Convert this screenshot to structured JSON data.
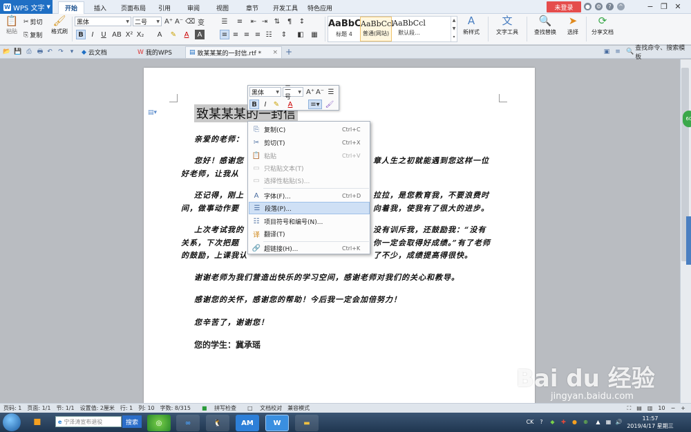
{
  "app": {
    "name": "WPS 文字"
  },
  "menu": [
    "开始",
    "插入",
    "页面布局",
    "引用",
    "审阅",
    "视图",
    "章节",
    "开发工具",
    "特色应用"
  ],
  "login_label": "未登录",
  "ribbon": {
    "paste": "粘贴",
    "cut": "剪切",
    "copy": "复制",
    "format_painter": "格式刷",
    "font_name": "黑体",
    "font_size": "二号",
    "styles": [
      {
        "preview": "AaBbC",
        "name": "标题 4"
      },
      {
        "preview": "AaBbCcl",
        "name": "普通(网站)"
      },
      {
        "preview": "AaBbCcl",
        "name": "默认段..."
      }
    ],
    "new_style": "新样式",
    "text_tools": "文字工具",
    "find_replace": "查找替换",
    "select": "选择",
    "share_doc": "分享文档"
  },
  "tabs": [
    {
      "label": "云文档",
      "active": false
    },
    {
      "label": "我的WPS",
      "active": false
    },
    {
      "label": "致某某某的一封信.rtf *",
      "active": true
    }
  ],
  "search_cmd": "查找命令、搜索模板",
  "document": {
    "title": "致某某某的一封信",
    "lines": [
      "亲爱的老师：",
      "您好！感谢您",
      "章人生之初就能遇到您这样一位",
      "好老师，让我从",
      "还记得，刚上",
      "拉拉，是您教育我，不要浪费时",
      "间，做事动作要",
      "向着我，使我有了很大的进步。",
      "上次考试我的",
      "没有训斥我，还鼓励我：“没有",
      "关系，下次把题",
      "你一定会取得好成绩。”有了老师",
      "的鼓励，上课我认",
      "了不少，成绩提高得很快。",
      "谢谢老师为我们营造出快乐的学习空间，感谢老师对我们的关心和教导。",
      "感谢您的关怀，感谢您的帮助！今后我一定会加倍努力！",
      "您辛苦了，谢谢您！"
    ],
    "signature": "您的学生：冀承瑶"
  },
  "minibar": {
    "font_name": "黑体",
    "font_size": "二号",
    "bold": "B",
    "italic": "I"
  },
  "context_menu": [
    {
      "label": "复制(C)",
      "shortcut": "Ctrl+C",
      "icon": "copy-icon",
      "disabled": false,
      "highlight": false
    },
    {
      "label": "剪切(T)",
      "shortcut": "Ctrl+X",
      "icon": "cut-icon",
      "disabled": false,
      "highlight": false
    },
    {
      "label": "粘贴",
      "shortcut": "Ctrl+V",
      "icon": "paste-icon",
      "disabled": true,
      "highlight": false
    },
    {
      "label": "只粘贴文本(T)",
      "shortcut": "",
      "icon": "paste-text-icon",
      "disabled": true,
      "highlight": false
    },
    {
      "label": "选择性粘贴(S)...",
      "shortcut": "",
      "icon": "paste-special-icon",
      "disabled": true,
      "highlight": false
    },
    {
      "label": "字体(F)...",
      "shortcut": "Ctrl+D",
      "icon": "font-icon",
      "disabled": false,
      "highlight": false
    },
    {
      "label": "段落(P)...",
      "shortcut": "",
      "icon": "paragraph-icon",
      "disabled": false,
      "highlight": true
    },
    {
      "label": "项目符号和编号(N)...",
      "shortcut": "",
      "icon": "bullets-icon",
      "disabled": false,
      "highlight": false
    },
    {
      "label": "翻译(T)",
      "shortcut": "",
      "icon": "translate-icon",
      "disabled": false,
      "highlight": false
    },
    {
      "label": "超链接(H)...",
      "shortcut": "Ctrl+K",
      "icon": "hyperlink-icon",
      "disabled": false,
      "highlight": false
    }
  ],
  "status": {
    "page": "页码: 1",
    "pages": "页面: 1/1",
    "section": "节: 1/1",
    "setting": "设置值: 2厘米",
    "row": "行: 1",
    "col": "列: 10",
    "words": "字数: 8/315",
    "spell": "拼写检查",
    "proof": "文档校对",
    "compat": "兼容模式",
    "zoom": "10"
  },
  "side_badge": "60",
  "taskbar": {
    "search_placeholder": "宁泽涛宣布退役",
    "search_btn": "搜索",
    "app_am": "AM",
    "app_w": "W",
    "ime": "CK",
    "time": "11:57",
    "date": "2019/4/17 星期三"
  },
  "watermark": {
    "logo": "Bai du 经验",
    "url": "jingyan.baidu.com"
  }
}
